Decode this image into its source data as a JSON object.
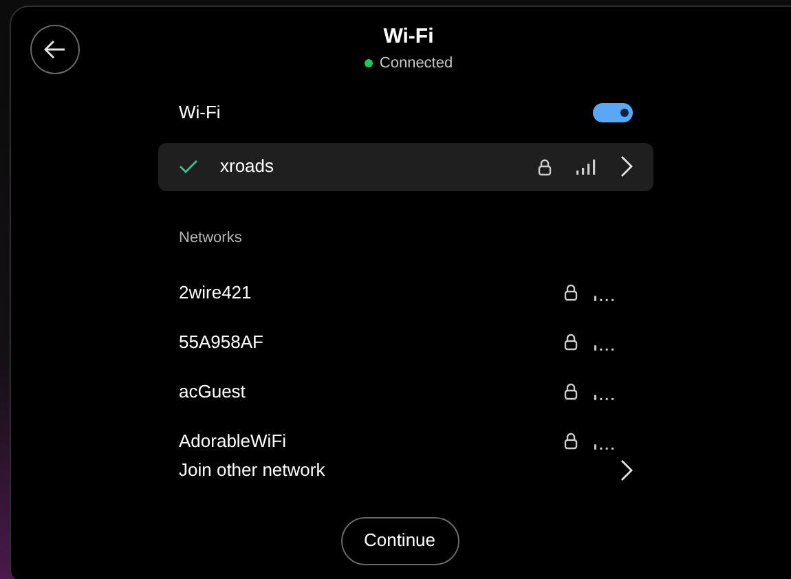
{
  "header": {
    "title": "Wi-Fi",
    "status": "Connected"
  },
  "wifi_toggle": {
    "label": "Wi-Fi",
    "on": true
  },
  "connected_network": {
    "name": "xroads",
    "checked": true
  },
  "networks_label": "Networks",
  "networks": [
    {
      "name": "2wire421",
      "locked": true
    },
    {
      "name": "55A958AF",
      "locked": true
    },
    {
      "name": "acGuest",
      "locked": true
    },
    {
      "name": "AdorableWiFi",
      "locked": true
    }
  ],
  "join_other": "Join other network",
  "continue_button": "Continue"
}
